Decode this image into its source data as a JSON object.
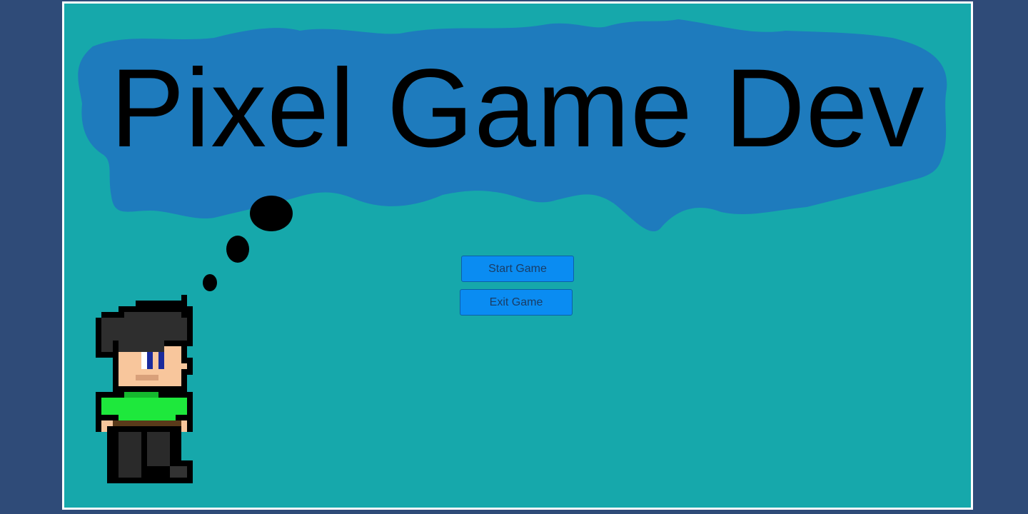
{
  "title": "Pixel Game Dev",
  "menu": {
    "start_label": "Start Game",
    "exit_label": "Exit Game"
  },
  "colors": {
    "background": "#16a8ab",
    "cloud": "#1e7bbd",
    "button": "#0a8cf2",
    "shirt": "#1ee83c",
    "hair": "#252525",
    "skin": "#f8c69c"
  },
  "icons": {
    "character": "pixel-boy-sprite",
    "thought_bubble": "thought-bubble"
  }
}
